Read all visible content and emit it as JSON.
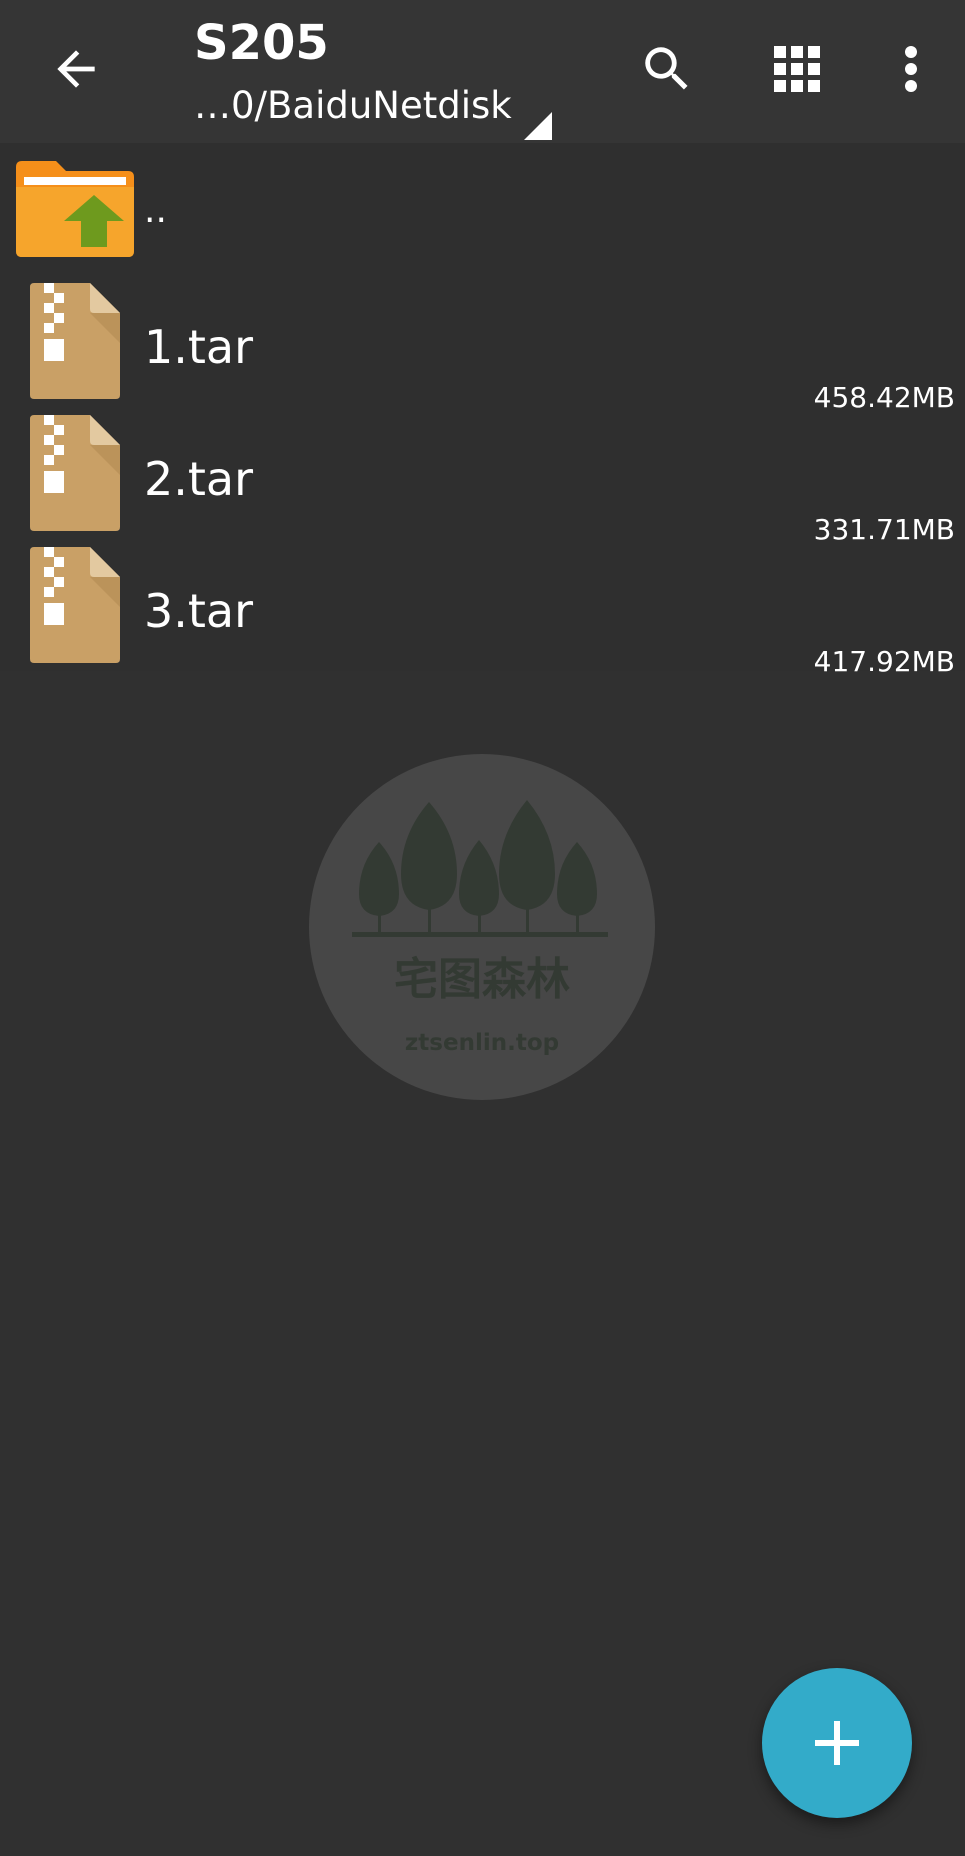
{
  "toolbar": {
    "title": "S205",
    "path": "…0/BaiduNetdisk",
    "icons": {
      "back": "arrow-left-icon",
      "search": "search-icon",
      "view": "grid-icon",
      "more": "more-vert-icon"
    }
  },
  "files": {
    "parent_label": "..",
    "items": [
      {
        "name": "1.tar",
        "size": "458.42MB"
      },
      {
        "name": "2.tar",
        "size": "331.71MB"
      },
      {
        "name": "3.tar",
        "size": "417.92MB"
      }
    ]
  },
  "watermark": {
    "title": "宅图森林",
    "url": "ztsenlin.top"
  },
  "colors": {
    "background": "#303030",
    "toolbar": "#353535",
    "fab": "#33abc9",
    "folder": "#f5a623",
    "archive": "#c9a066"
  }
}
